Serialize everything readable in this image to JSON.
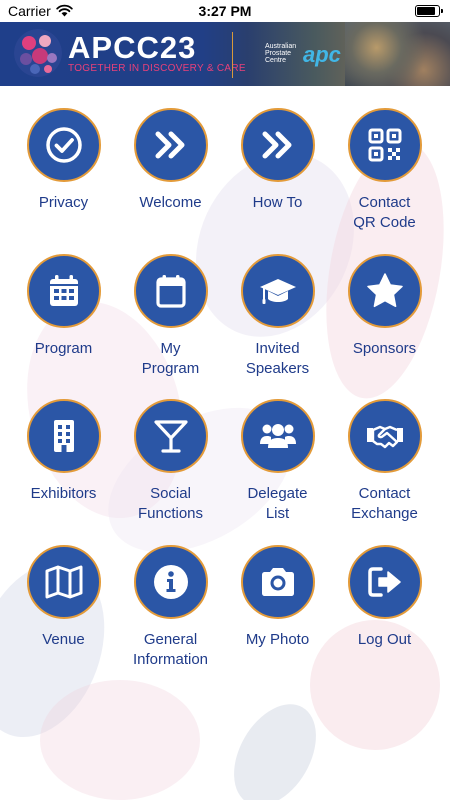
{
  "status_bar": {
    "carrier": "Carrier",
    "time": "3:27 PM",
    "battery_level": 0.9
  },
  "banner": {
    "title": "APCC23",
    "tagline": "TOGETHER IN DISCOVERY & CARE",
    "partner_text": "Australian Prostate Centre",
    "partner_logo": "apc"
  },
  "accent_colors": {
    "circle": "#2b56a6",
    "ring": "#e39b3a",
    "label": "#1f3b8a",
    "tagline": "#e8407a"
  },
  "menu": [
    {
      "line1": "Privacy",
      "line2": "",
      "icon": "check-circle-icon"
    },
    {
      "line1": "Welcome",
      "line2": "",
      "icon": "double-chevron-icon"
    },
    {
      "line1": "How To",
      "line2": "",
      "icon": "double-chevron-icon"
    },
    {
      "line1": "Contact",
      "line2": "QR Code",
      "icon": "qr-code-icon"
    },
    {
      "line1": "Program",
      "line2": "",
      "icon": "calendar-grid-icon"
    },
    {
      "line1": "My",
      "line2": "Program",
      "icon": "calendar-icon"
    },
    {
      "line1": "Invited",
      "line2": "Speakers",
      "icon": "graduation-cap-icon"
    },
    {
      "line1": "Sponsors",
      "line2": "",
      "icon": "star-icon"
    },
    {
      "line1": "Exhibitors",
      "line2": "",
      "icon": "building-icon"
    },
    {
      "line1": "Social",
      "line2": "Functions",
      "icon": "cocktail-icon"
    },
    {
      "line1": "Delegate",
      "line2": "List",
      "icon": "users-icon"
    },
    {
      "line1": "Contact",
      "line2": "Exchange",
      "icon": "handshake-icon"
    },
    {
      "line1": "Venue",
      "line2": "",
      "icon": "map-icon"
    },
    {
      "line1": "General",
      "line2": "Information",
      "icon": "info-icon"
    },
    {
      "line1": "My Photo",
      "line2": "",
      "icon": "camera-icon"
    },
    {
      "line1": "Log Out",
      "line2": "",
      "icon": "logout-icon"
    }
  ]
}
